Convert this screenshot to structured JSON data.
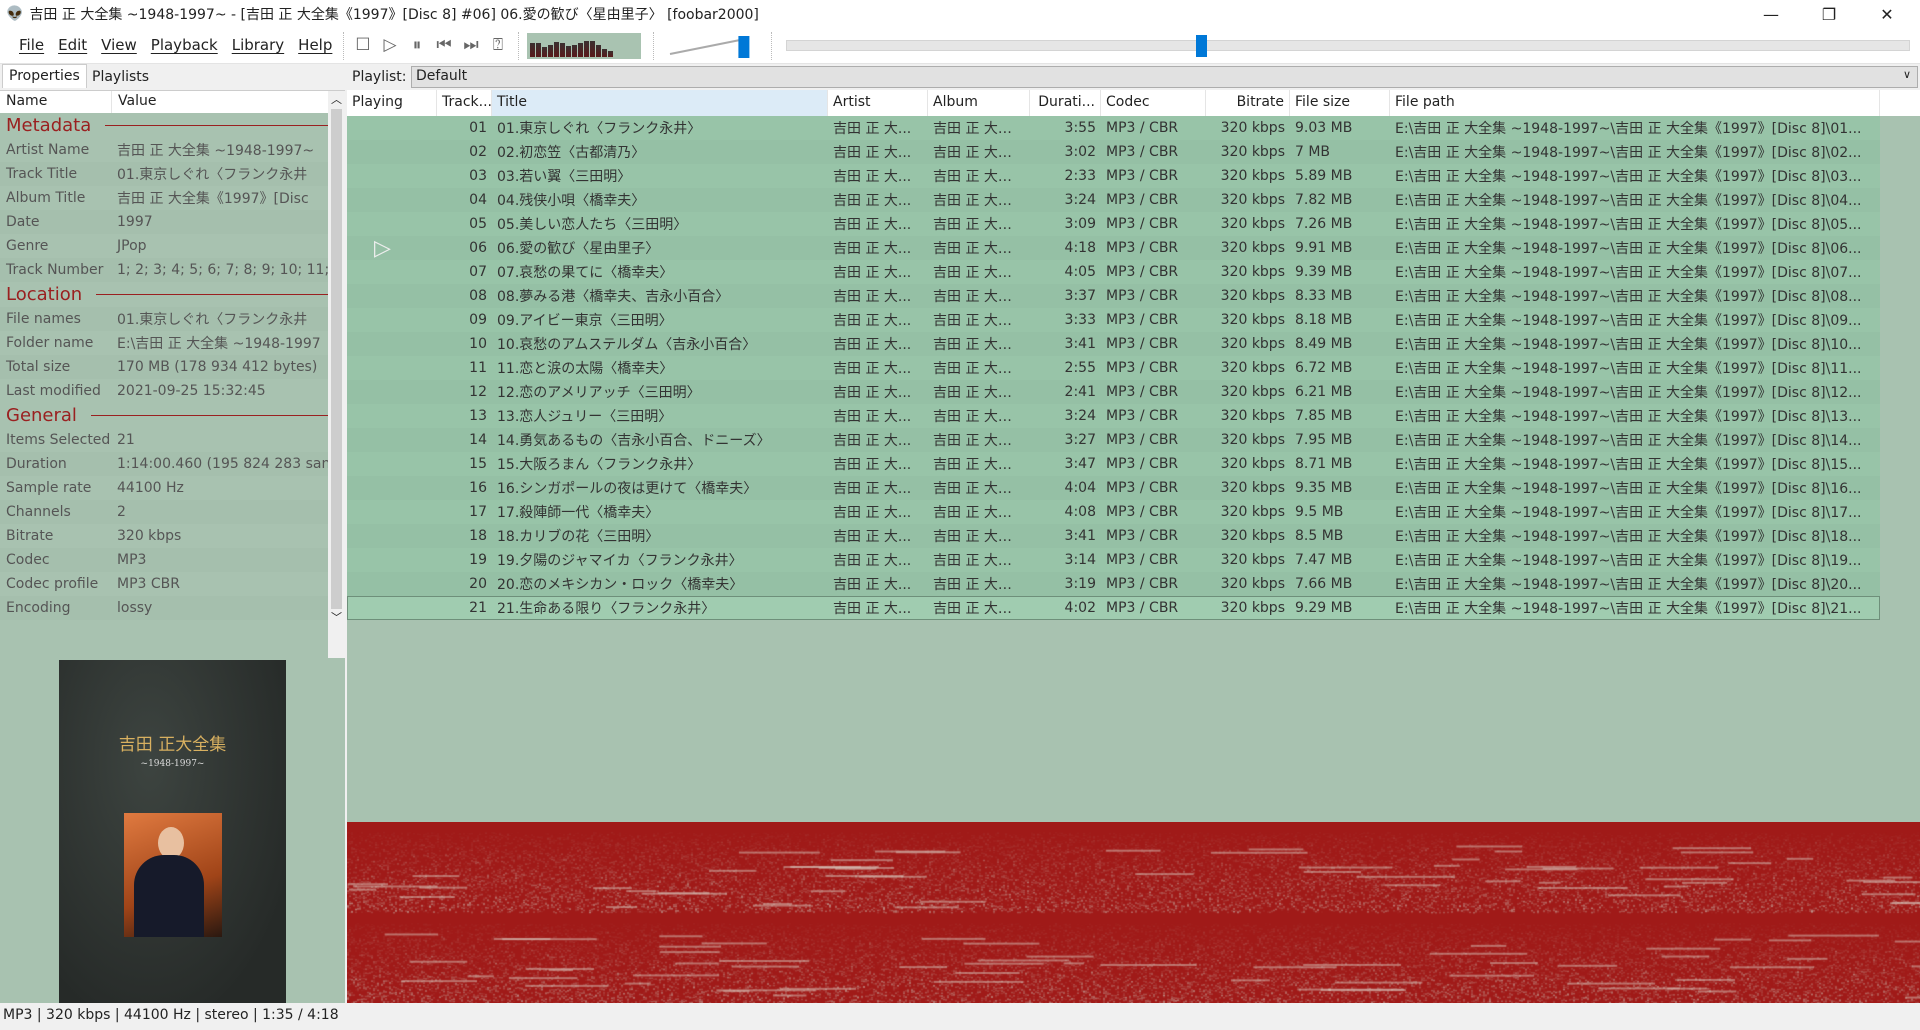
{
  "window": {
    "title": "吉田 正 大全集 ~1948-1997~ - [吉田 正 大全集《1997》[Disc 8] #06] 06.愛の歓び〈星由里子〉 [foobar2000]",
    "app_icon": "foobar-alien-icon"
  },
  "menu": [
    "File",
    "Edit",
    "View",
    "Playback",
    "Library",
    "Help"
  ],
  "transport": {
    "icons": [
      "stop-icon",
      "play-icon",
      "pause-icon",
      "previous-icon",
      "next-icon",
      "random-icon"
    ],
    "volume_fraction": 0.95,
    "seek_fraction": 0.368
  },
  "tabs": [
    "Properties",
    "Playlists"
  ],
  "properties": {
    "columns": [
      "Name",
      "Value"
    ],
    "sections": [
      {
        "title": "Metadata",
        "rows": [
          [
            "Artist Name",
            "吉田 正 大全集 ~1948-1997~"
          ],
          [
            "Track Title",
            "01.東京しぐれ〈フランク永井"
          ],
          [
            "Album Title",
            "吉田 正 大全集《1997》[Disc"
          ],
          [
            "Date",
            "1997"
          ],
          [
            "Genre",
            "JPop"
          ],
          [
            "Track Number",
            "1; 2; 3; 4; 5; 6; 7; 8; 9; 10; 11; 1"
          ]
        ]
      },
      {
        "title": "Location",
        "rows": [
          [
            "File names",
            "01.東京しぐれ〈フランク永井"
          ],
          [
            "Folder name",
            "E:\\吉田 正 大全集 ~1948-1997"
          ],
          [
            "Total size",
            "170 MB (178 934 412 bytes)"
          ],
          [
            "Last modified",
            "2021-09-25 15:32:45"
          ]
        ]
      },
      {
        "title": "General",
        "rows": [
          [
            "Items Selected",
            "21"
          ],
          [
            "Duration",
            "1:14:00.460 (195 824 283 san"
          ],
          [
            "Sample rate",
            "44100 Hz"
          ],
          [
            "Channels",
            "2"
          ],
          [
            "Bitrate",
            "320 kbps"
          ],
          [
            "Codec",
            "MP3"
          ],
          [
            "Codec profile",
            "MP3 CBR"
          ],
          [
            "Encoding",
            "lossy"
          ]
        ]
      }
    ]
  },
  "album_art": {
    "title": "吉田 正大全集",
    "subtitle": "~1948-1997~"
  },
  "playlist": {
    "label": "Playlist:",
    "selected": "Default",
    "columns": [
      "Playing",
      "Track...",
      "Title",
      "Artist",
      "Album",
      "Durati...",
      "Codec",
      "Bitrate",
      "File size",
      "File path"
    ],
    "playing_index": 5,
    "focused_index": 20,
    "rows": [
      [
        "01",
        "01.東京しぐれ〈フランク永井〉",
        "3:55",
        "9.03 MB"
      ],
      [
        "02",
        "02.初恋笠〈古都清乃〉",
        "3:02",
        "7 MB"
      ],
      [
        "03",
        "03.若い翼〈三田明〉",
        "2:33",
        "5.89 MB"
      ],
      [
        "04",
        "04.残侠小唄〈橋幸夫〉",
        "3:24",
        "7.82 MB"
      ],
      [
        "05",
        "05.美しい恋人たち〈三田明〉",
        "3:09",
        "7.26 MB"
      ],
      [
        "06",
        "06.愛の歓び〈星由里子〉",
        "4:18",
        "9.91 MB"
      ],
      [
        "07",
        "07.哀愁の果てに〈橋幸夫〉",
        "4:05",
        "9.39 MB"
      ],
      [
        "08",
        "08.夢みる港〈橋幸夫、吉永小百合〉",
        "3:37",
        "8.33 MB"
      ],
      [
        "09",
        "09.アイビー東京〈三田明〉",
        "3:33",
        "8.18 MB"
      ],
      [
        "10",
        "10.哀愁のアムステルダム〈吉永小百合〉",
        "3:41",
        "8.49 MB"
      ],
      [
        "11",
        "11.恋と涙の太陽〈橋幸夫〉",
        "2:55",
        "6.72 MB"
      ],
      [
        "12",
        "12.恋のアメリアッチ〈三田明〉",
        "2:41",
        "6.21 MB"
      ],
      [
        "13",
        "13.恋人ジュリー〈三田明〉",
        "3:24",
        "7.85 MB"
      ],
      [
        "14",
        "14.勇気あるもの〈吉永小百合、ドニーズ〉",
        "3:27",
        "7.95 MB"
      ],
      [
        "15",
        "15.大阪ろまん〈フランク永井〉",
        "3:47",
        "8.71 MB"
      ],
      [
        "16",
        "16.シンガポールの夜は更けて〈橋幸夫〉",
        "4:04",
        "9.35 MB"
      ],
      [
        "17",
        "17.殺陣師一代〈橋幸夫〉",
        "4:08",
        "9.5 MB"
      ],
      [
        "18",
        "18.カリブの花〈三田明〉",
        "3:41",
        "8.5 MB"
      ],
      [
        "19",
        "19.夕陽のジャマイカ〈フランク永井〉",
        "3:14",
        "7.47 MB"
      ],
      [
        "20",
        "20.恋のメキシカン・ロック〈橋幸夫〉",
        "3:19",
        "7.66 MB"
      ],
      [
        "21",
        "21.生命ある限り〈フランク永井〉",
        "4:02",
        "9.29 MB"
      ]
    ],
    "artist": "吉田 正 大...",
    "album": "吉田 正 大全...",
    "codec": "MP3 / CBR",
    "bitrate": "320 kbps",
    "path_prefix": "E:\\吉田 正 大全集 ~1948-1997~\\吉田 正 大全集《1997》[Disc 8]\\"
  },
  "status": "MP3 | 320 kbps | 44100 Hz | stereo | 1:35 / 4:18",
  "colors": {
    "panel_bg": "#a8c2b0",
    "row_bg": "#98c4a8",
    "accent": "#0078d7",
    "section": "#9a2020",
    "spectrogram": "#a01a18"
  }
}
